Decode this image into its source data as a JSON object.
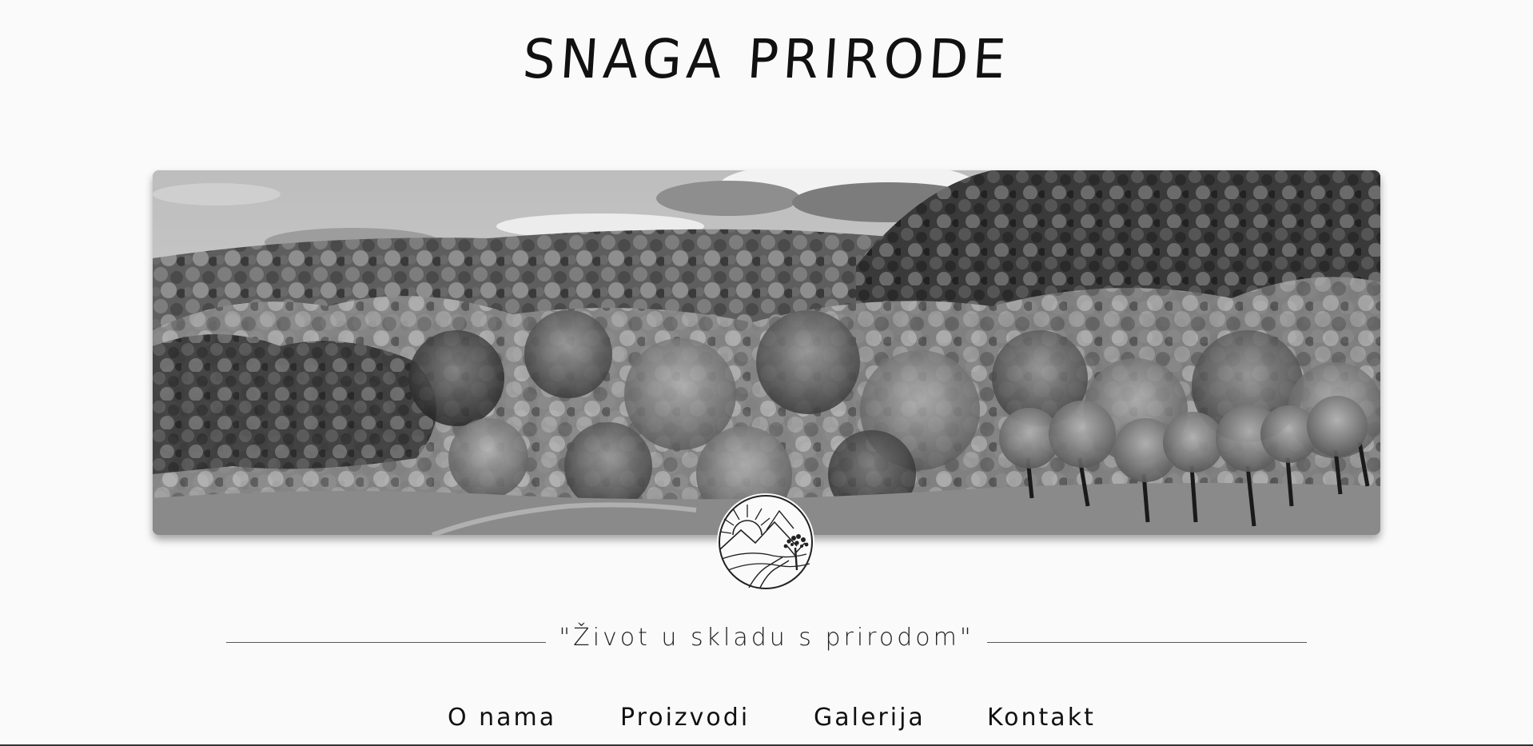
{
  "header": {
    "site_title": "SNAGA PRIRODE"
  },
  "hero": {
    "image_alt": "Black and white photo of forested hills under a cloudy sky",
    "emblem_icon": "sun-mountains-tree-emblem-icon"
  },
  "tagline": {
    "text": "\"Život u skladu s prirodom\""
  },
  "nav": {
    "items": [
      {
        "label": "O nama"
      },
      {
        "label": "Proizvodi"
      },
      {
        "label": "Galerija"
      },
      {
        "label": "Kontakt"
      }
    ]
  },
  "colors": {
    "background": "#fafafa",
    "text": "#111111",
    "line": "#555555"
  }
}
